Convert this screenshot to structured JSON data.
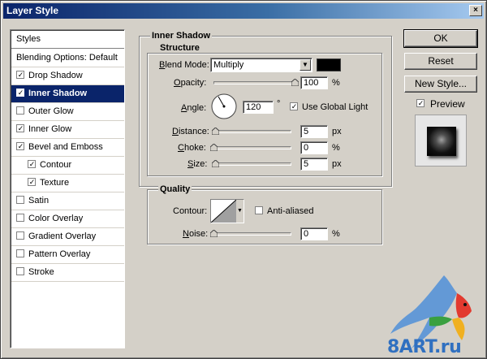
{
  "window": {
    "title": "Layer Style",
    "close_label": "×"
  },
  "styles_list": {
    "header": "Styles",
    "items": [
      {
        "label": "Blending Options: Default",
        "checkbox": false,
        "checked": false,
        "indent": false,
        "selected": false
      },
      {
        "label": "Drop Shadow",
        "checkbox": true,
        "checked": true,
        "indent": false,
        "selected": false
      },
      {
        "label": "Inner Shadow",
        "checkbox": true,
        "checked": true,
        "indent": false,
        "selected": true
      },
      {
        "label": "Outer Glow",
        "checkbox": true,
        "checked": false,
        "indent": false,
        "selected": false
      },
      {
        "label": "Inner Glow",
        "checkbox": true,
        "checked": true,
        "indent": false,
        "selected": false
      },
      {
        "label": "Bevel and Emboss",
        "checkbox": true,
        "checked": true,
        "indent": false,
        "selected": false
      },
      {
        "label": "Contour",
        "checkbox": true,
        "checked": true,
        "indent": true,
        "selected": false
      },
      {
        "label": "Texture",
        "checkbox": true,
        "checked": true,
        "indent": true,
        "selected": false
      },
      {
        "label": "Satin",
        "checkbox": true,
        "checked": false,
        "indent": false,
        "selected": false
      },
      {
        "label": "Color Overlay",
        "checkbox": true,
        "checked": false,
        "indent": false,
        "selected": false
      },
      {
        "label": "Gradient Overlay",
        "checkbox": true,
        "checked": false,
        "indent": false,
        "selected": false
      },
      {
        "label": "Pattern Overlay",
        "checkbox": true,
        "checked": false,
        "indent": false,
        "selected": false
      },
      {
        "label": "Stroke",
        "checkbox": true,
        "checked": false,
        "indent": false,
        "selected": false
      }
    ]
  },
  "panel": {
    "title": "Inner Shadow",
    "structure": {
      "title": "Structure",
      "blend_mode_label": "Blend Mode:",
      "blend_mode_value": "Multiply",
      "blend_color": "#000000",
      "opacity_label": "Opacity:",
      "opacity_value": "100",
      "opacity_unit": "%",
      "opacity_fraction": 1.0,
      "angle_label": "Angle:",
      "angle_value": "120",
      "angle_unit": "°",
      "angle_degrees": 120,
      "global_light_label": "Use Global Light",
      "global_light_checked": true,
      "distance_label": "Distance:",
      "distance_value": "5",
      "distance_unit": "px",
      "distance_fraction": 0.02,
      "choke_label": "Choke:",
      "choke_value": "0",
      "choke_unit": "%",
      "choke_fraction": 0.0,
      "size_label": "Size:",
      "size_value": "5",
      "size_unit": "px",
      "size_fraction": 0.02
    },
    "quality": {
      "title": "Quality",
      "contour_label": "Contour:",
      "anti_aliased_label": "Anti-aliased",
      "anti_aliased_checked": false,
      "noise_label": "Noise:",
      "noise_value": "0",
      "noise_unit": "%",
      "noise_fraction": 0.0
    }
  },
  "buttons": {
    "ok": "OK",
    "reset": "Reset",
    "new_style": "New Style...",
    "preview_label": "Preview",
    "preview_checked": true
  },
  "watermark": {
    "text": "8ART.ru"
  },
  "colors": {
    "selection": "#0a246a",
    "face": "#d4d0c8"
  }
}
